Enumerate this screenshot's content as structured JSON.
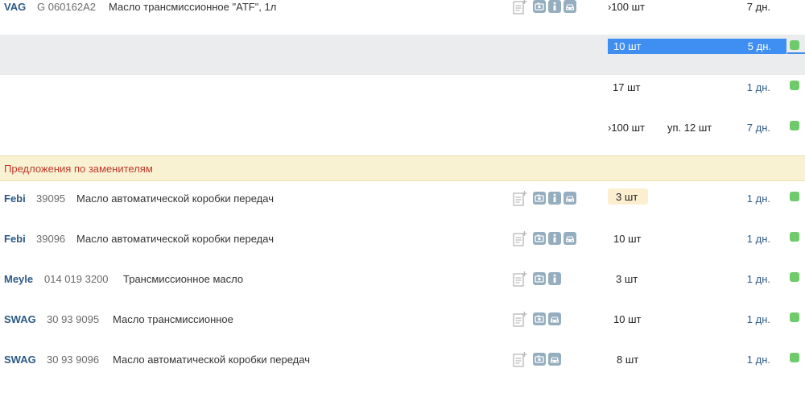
{
  "main_product": {
    "brand": "VAG",
    "code": "G 060162A2",
    "description": "Масло трансмиссионное \"ATF\", 1л",
    "offers": [
      {
        "qty": "›100 шт",
        "packing": "",
        "days": "7 дн.",
        "selected": false
      },
      {
        "qty": "10 шт",
        "packing": "",
        "days": "5 дн.",
        "selected": true
      },
      {
        "qty": "17 шт",
        "packing": "",
        "days": "1 дн.",
        "selected": false
      },
      {
        "qty": "›100 шт",
        "packing": "уп. 12 шт",
        "days": "7 дн.",
        "selected": false
      }
    ]
  },
  "replacements_header": "Предложения по заменителям",
  "replacements": [
    {
      "brand": "Febi",
      "code": "39095",
      "description": "Масло автоматической коробки передач",
      "qty": "3 шт",
      "days": "1 дн.",
      "icons": [
        "photo-icon",
        "info-icon",
        "car-icon"
      ]
    },
    {
      "brand": "Febi",
      "code": "39096",
      "description": "Масло автоматической коробки передач",
      "qty": "10 шт",
      "days": "1 дн.",
      "icons": [
        "photo-icon",
        "info-icon",
        "car-icon"
      ]
    },
    {
      "brand": "Meyle",
      "code": "014 019 3200",
      "description": "Трансмиссионное масло",
      "qty": "3 шт",
      "days": "1 дн.",
      "icons": [
        "photo-icon",
        "info-icon"
      ]
    },
    {
      "brand": "SWAG",
      "code": "30 93 9095",
      "description": "Масло трансмиссионное",
      "qty": "10 шт",
      "days": "1 дн.",
      "icons": [
        "photo-icon",
        "car-icon"
      ]
    },
    {
      "brand": "SWAG",
      "code": "30 93 9096",
      "description": "Масло автоматической коробки передач",
      "qty": "8 шт",
      "days": "1 дн.",
      "icons": [
        "photo-icon",
        "car-icon"
      ]
    }
  ],
  "colors": {
    "brand_link": "#2c5a85",
    "selected_row": "#3f8ef2",
    "status_ok": "#6fca6b",
    "section_header_bg": "#f8f2d3",
    "section_header_text": "#c0392b",
    "qty_badge_bg": "#fbefcf",
    "icon_bg": "#95aebf"
  }
}
